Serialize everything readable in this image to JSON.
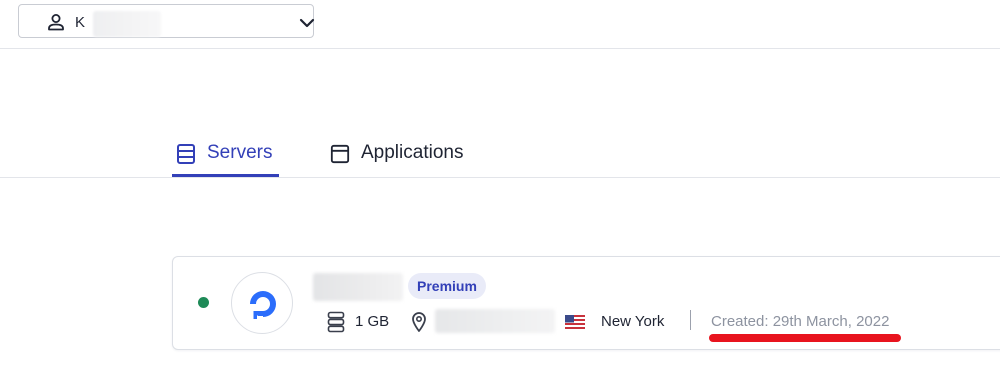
{
  "header": {
    "account_selector": {
      "name": "K",
      "icon": "user-icon",
      "dropdown_icon": "chevron-down-icon"
    }
  },
  "tabs": [
    {
      "label": "Servers",
      "icon": "server-stack-icon",
      "active": true
    },
    {
      "label": "Applications",
      "icon": "window-icon",
      "active": false
    }
  ],
  "server": {
    "status": "online",
    "status_color": "#1e8a57",
    "provider_icon": "digitalocean-logo",
    "plan_badge": "Premium",
    "size": "1 GB",
    "region": "New York",
    "region_flag": "us-flag-icon",
    "created": "Created: 29th March, 2022"
  },
  "colors": {
    "accent": "#3340b8",
    "highlight": "#e8141e"
  }
}
